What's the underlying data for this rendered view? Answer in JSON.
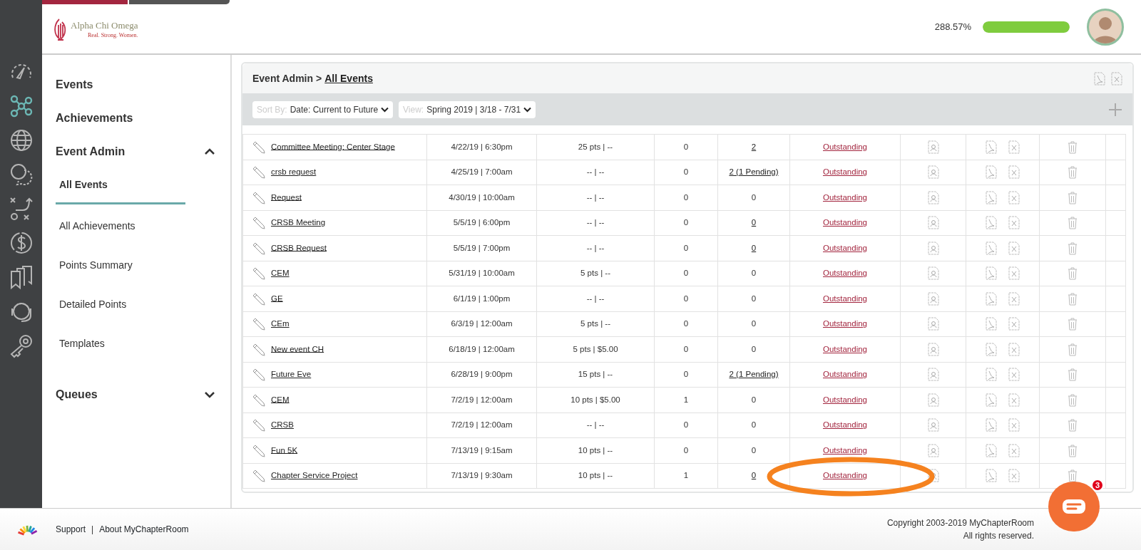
{
  "header": {
    "logo": {
      "name": "Alpha Chi Omega",
      "tagline": "Real. Strong. Women."
    },
    "progress": {
      "reading": "288.57%",
      "level": 1
    }
  },
  "rail": [
    {
      "kind": "gauge",
      "selected": false
    },
    {
      "kind": "network",
      "selected": true
    },
    {
      "kind": "globe",
      "selected": false
    },
    {
      "kind": "chat",
      "selected": false
    },
    {
      "kind": "play",
      "selected": false
    },
    {
      "kind": "dollar",
      "selected": false
    },
    {
      "kind": "bookmarks",
      "selected": false
    },
    {
      "kind": "headset",
      "selected": false
    },
    {
      "kind": "key",
      "selected": false
    }
  ],
  "sidebar": {
    "items": [
      {
        "label": "Events"
      },
      {
        "label": "Achievements"
      },
      {
        "label": "Event Admin",
        "expanded": true,
        "children": [
          {
            "label": "All Events",
            "selected": true
          },
          {
            "label": "All Achievements",
            "selected": false
          },
          {
            "label": "Points Summary",
            "selected": false
          },
          {
            "label": "Detailed Points",
            "selected": false
          },
          {
            "label": "Templates",
            "selected": false
          }
        ]
      },
      {
        "label": "Queues",
        "expanded": false
      }
    ]
  },
  "panel": {
    "breadcrumb": {
      "parent": "Event Admin",
      "separator": ">",
      "current": "All Events"
    },
    "sort": {
      "label": "Sort By:",
      "value": "Date: Current to Future"
    },
    "view": {
      "label": "View:",
      "value": "Spring 2019 | 3/18 - 7/31"
    },
    "rows": [
      {
        "name": "Committee Meeting: Center Stage",
        "date": "4/22/19 | 6:30pm",
        "points": "25 pts | --",
        "column_4": "0",
        "column_5": "2",
        "column_5_linked": true,
        "status": "Outstanding",
        "highlighted": false
      },
      {
        "name": "crsb request",
        "date": "4/25/19 | 7:00am",
        "points": "-- | --",
        "column_4": "0",
        "column_5": "2 (1 Pending)",
        "column_5_linked": true,
        "status": "Outstanding",
        "highlighted": false
      },
      {
        "name": "Request",
        "date": "4/30/19 | 10:00am",
        "points": "-- | --",
        "column_4": "0",
        "column_5": "0",
        "column_5_linked": false,
        "status": "Outstanding",
        "highlighted": false
      },
      {
        "name": "CRSB Meeting",
        "date": "5/5/19 | 6:00pm",
        "points": "-- | --",
        "column_4": "0",
        "column_5": "0",
        "column_5_linked": true,
        "status": "Outstanding",
        "highlighted": false
      },
      {
        "name": "CRSB Request",
        "date": "5/5/19 | 7:00pm",
        "points": "-- | --",
        "column_4": "0",
        "column_5": "0",
        "column_5_linked": true,
        "status": "Outstanding",
        "highlighted": false
      },
      {
        "name": "CEM",
        "date": "5/31/19 | 10:00am",
        "points": "5 pts | --",
        "column_4": "0",
        "column_5": "0",
        "column_5_linked": false,
        "status": "Outstanding",
        "highlighted": false
      },
      {
        "name": "GE",
        "date": "6/1/19 | 1:00pm",
        "points": "-- | --",
        "column_4": "0",
        "column_5": "0",
        "column_5_linked": false,
        "status": "Outstanding",
        "highlighted": false
      },
      {
        "name": "CEm",
        "date": "6/3/19 | 12:00am",
        "points": "5 pts | --",
        "column_4": "0",
        "column_5": "0",
        "column_5_linked": false,
        "status": "Outstanding",
        "highlighted": false
      },
      {
        "name": "New event CH",
        "date": "6/18/19 | 12:00am",
        "points": "5 pts | $5.00",
        "column_4": "0",
        "column_5": "0",
        "column_5_linked": false,
        "status": "Outstanding",
        "highlighted": false
      },
      {
        "name": "Future Eve",
        "date": "6/28/19 | 9:00pm",
        "points": "15 pts | --",
        "column_4": "0",
        "column_5": "2 (1 Pending)",
        "column_5_linked": true,
        "status": "Outstanding",
        "highlighted": false
      },
      {
        "name": "CEM",
        "date": "7/2/19 | 12:00am",
        "points": "10 pts | $5.00",
        "column_4": "1",
        "column_5": "0",
        "column_5_linked": false,
        "status": "Outstanding",
        "highlighted": false
      },
      {
        "name": "CRSB",
        "date": "7/2/19 | 12:00am",
        "points": "-- | --",
        "column_4": "0",
        "column_5": "0",
        "column_5_linked": false,
        "status": "Outstanding",
        "highlighted": false
      },
      {
        "name": "Fun 5K",
        "date": "7/13/19 | 9:15am",
        "points": "10 pts | --",
        "column_4": "0",
        "column_5": "0",
        "column_5_linked": false,
        "status": "Outstanding",
        "highlighted": false
      },
      {
        "name": "Chapter Service Project",
        "date": "7/13/19 | 9:30am",
        "points": "10 pts | --",
        "column_4": "1",
        "column_5": "0",
        "column_5_linked": true,
        "status": "Outstanding",
        "highlighted": true
      }
    ]
  },
  "footer": {
    "links": [
      "Support",
      "About MyChapterRoom"
    ],
    "separator": "|",
    "copyright": "Copyright 2003-2019 MyChapterRoom",
    "rights": "All rights reserved."
  },
  "chat": {
    "badge": "3"
  }
}
